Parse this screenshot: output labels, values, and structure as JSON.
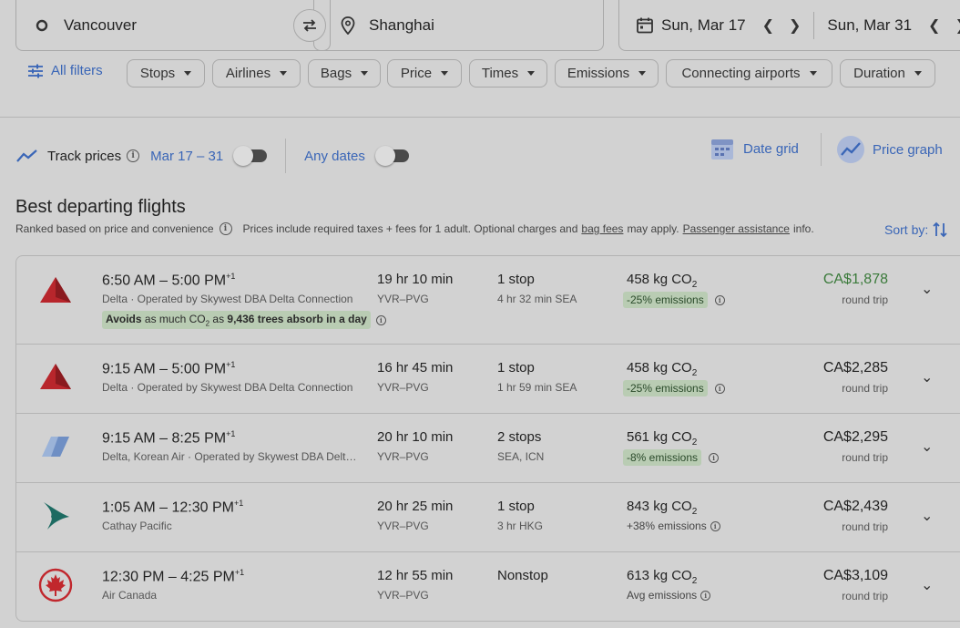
{
  "search": {
    "origin": "Vancouver",
    "destination": "Shanghai",
    "depart_date": "Sun, Mar 17",
    "return_date": "Sun, Mar 31"
  },
  "filters": {
    "all_filters": "All filters",
    "chips": [
      "Stops",
      "Airlines",
      "Bags",
      "Price",
      "Times",
      "Emissions",
      "Connecting airports",
      "Duration"
    ]
  },
  "track": {
    "label": "Track prices",
    "range": "Mar 17 – 31",
    "any_dates": "Any dates",
    "date_grid": "Date grid",
    "price_graph": "Price graph"
  },
  "section": {
    "title": "Best departing flights",
    "ranked": "Ranked based on price and convenience",
    "prices_text_1": "Prices include required taxes + fees for 1 adult. Optional charges and",
    "bag_fees": "bag fees",
    "prices_text_2": "may apply.",
    "passenger_assistance": "Passenger assistance",
    "prices_text_3": "info.",
    "sort_by": "Sort by:"
  },
  "flights": [
    {
      "times": "6:50 AM – 5:00 PM",
      "plus": "+1",
      "airline": "Delta · Operated by Skywest DBA Delta Connection",
      "duration": "19 hr 10 min",
      "route": "YVR–PVG",
      "stops": "1 stop",
      "stop_info": "4 hr 32 min SEA",
      "co2": "458 kg CO",
      "co2_sub": "2",
      "emissions": "-25% emissions",
      "price": "CA$1,878",
      "trip": "round trip",
      "avoid_1": "Avoids",
      "avoid_2": "as much CO",
      "avoid_sub": "2",
      "avoid_3": "as",
      "avoid_4": "9,436 trees absorb in a day"
    },
    {
      "times": "9:15 AM – 5:00 PM",
      "plus": "+1",
      "airline": "Delta · Operated by Skywest DBA Delta Connection",
      "duration": "16 hr 45 min",
      "route": "YVR–PVG",
      "stops": "1 stop",
      "stop_info": "1 hr 59 min SEA",
      "co2": "458 kg CO",
      "co2_sub": "2",
      "emissions": "-25% emissions",
      "price": "CA$2,285",
      "trip": "round trip"
    },
    {
      "times": "9:15 AM – 8:25 PM",
      "plus": "+1",
      "airline": "Delta, Korean Air · Operated by Skywest DBA Delt…",
      "duration": "20 hr 10 min",
      "route": "YVR–PVG",
      "stops": "2 stops",
      "stop_info": "SEA, ICN",
      "co2": "561 kg CO",
      "co2_sub": "2",
      "emissions": "-8% emissions",
      "price": "CA$2,295",
      "trip": "round trip"
    },
    {
      "times": "1:05 AM – 12:30 PM",
      "plus": "+1",
      "airline": "Cathay Pacific",
      "duration": "20 hr 25 min",
      "route": "YVR–PVG",
      "stops": "1 stop",
      "stop_info": "3 hr HKG",
      "co2": "843 kg CO",
      "co2_sub": "2",
      "emissions": "+38% emissions",
      "price": "CA$2,439",
      "trip": "round trip"
    },
    {
      "times": "12:30 PM – 4:25 PM",
      "plus": "+1",
      "airline": "Air Canada",
      "duration": "12 hr 55 min",
      "route": "YVR–PVG",
      "stops": "Nonstop",
      "stop_info": "",
      "co2": "613 kg CO",
      "co2_sub": "2",
      "emissions": "Avg emissions",
      "price": "CA$3,109",
      "trip": "round trip"
    }
  ],
  "colors": {
    "accent": "#3a66b7",
    "good_price": "#3a7a3a",
    "emission_pill": "#b9ccb3",
    "delta_red": "#b8262c",
    "cathay_green": "#1d6b62",
    "aircanada_red": "#c1272d"
  }
}
